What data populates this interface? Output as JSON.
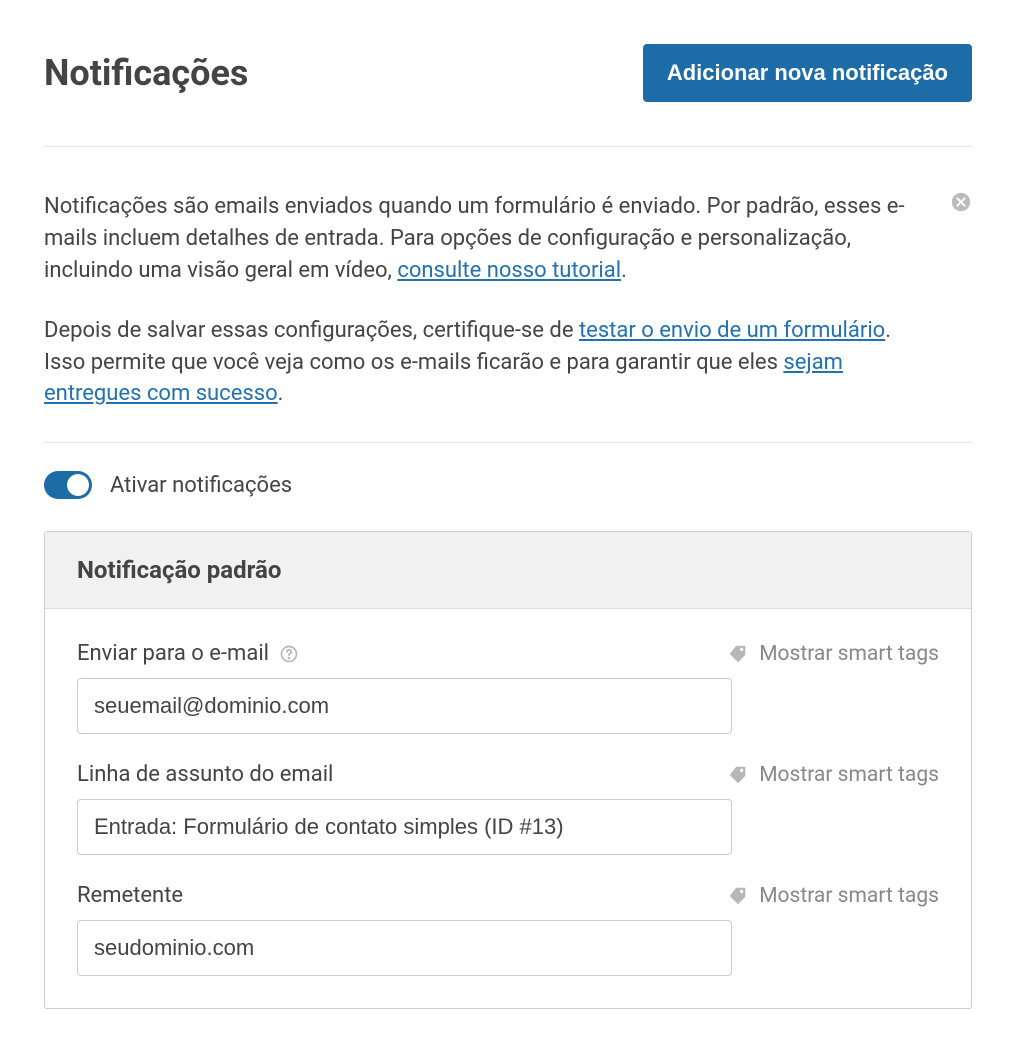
{
  "header": {
    "title": "Notificações",
    "add_button": "Adicionar nova notificação"
  },
  "info": {
    "p1_part1": "Notificações são emails enviados quando um formulário é enviado. Por padrão, esses e-mails incluem detalhes de entrada. Para opções de configuração e personalização, incluindo uma visão geral em vídeo, ",
    "p1_link": "consulte nosso tutorial",
    "p1_part2": ".",
    "p2_part1": "Depois de salvar essas configurações, certifique-se de ",
    "p2_link1": "testar o envio de um formulário",
    "p2_part2": ". Isso permite que você veja como os e-mails ficarão e para garantir que eles ",
    "p2_link2": "sejam entregues com sucesso",
    "p2_part3": "."
  },
  "toggle": {
    "label": "Ativar notificações",
    "enabled": true
  },
  "panel": {
    "title": "Notificação padrão",
    "smart_tags_label": "Mostrar smart tags",
    "fields": {
      "send_to": {
        "label": "Enviar para o e-mail",
        "value": "seuemail@dominio.com"
      },
      "subject": {
        "label": "Linha de assunto do email",
        "value": "Entrada: Formulário de contato simples (ID #13)"
      },
      "sender": {
        "label": "Remetente",
        "value": "seudominio.com"
      }
    }
  }
}
